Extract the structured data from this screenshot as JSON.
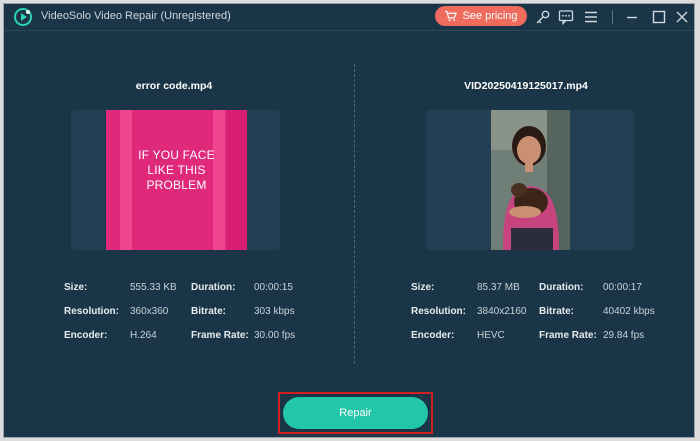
{
  "window": {
    "title": "VideoSolo Video Repair (Unregistered)",
    "pricing_label": "See pricing"
  },
  "toolbar_icons": [
    "cart-icon",
    "key-icon",
    "chat-icon",
    "menu-icon",
    "minimize-icon",
    "maximize-icon",
    "close-icon"
  ],
  "left": {
    "filename": "error code.mp4",
    "preview_text": "IF YOU FACE\nLIKE THIS\nPROBLEM",
    "size_label": "Size:",
    "size": "555.33 KB",
    "duration_label": "Duration:",
    "duration": "00:00:15",
    "resolution_label": "Resolution:",
    "resolution": "360x360",
    "bitrate_label": "Bitrate:",
    "bitrate": "303 kbps",
    "encoder_label": "Encoder:",
    "encoder": "H.264",
    "framerate_label": "Frame Rate:",
    "framerate": "30.00 fps"
  },
  "right": {
    "filename": "VID20250419125017.mp4",
    "size_label": "Size:",
    "size": "85.37 MB",
    "duration_label": "Duration:",
    "duration": "00:00:17",
    "resolution_label": "Resolution:",
    "resolution": "3840x2160",
    "bitrate_label": "Bitrate:",
    "bitrate": "40402 kbps",
    "encoder_label": "Encoder:",
    "encoder": "HEVC",
    "framerate_label": "Frame Rate:",
    "framerate": "29.84 fps"
  },
  "repair_label": "Repair",
  "colors": {
    "background": "#1a3547",
    "accent": "#22c6a8",
    "pricing": "#ee6b5d",
    "highlight": "#d0201f"
  }
}
